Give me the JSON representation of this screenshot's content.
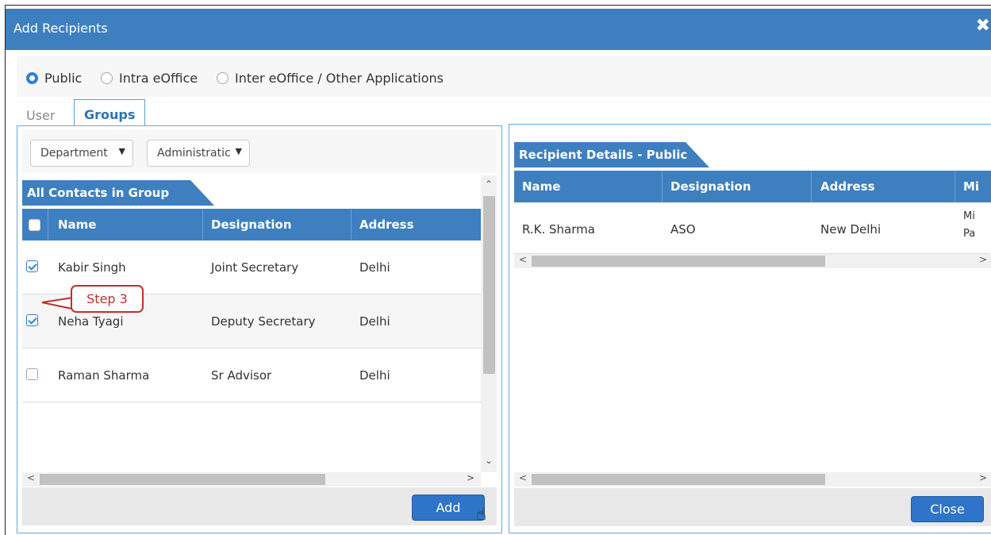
{
  "dialog": {
    "title": "Add Recipients",
    "close_icon": "close-icon"
  },
  "recipient_types": [
    {
      "label": "Public",
      "selected": true
    },
    {
      "label": "Intra eOffice",
      "selected": false
    },
    {
      "label": "Inter eOffice / Other Applications",
      "selected": false
    }
  ],
  "tabs": {
    "user": "User",
    "groups": "Groups",
    "active": "Groups"
  },
  "filters": {
    "category": "Department",
    "group": "Administratic"
  },
  "contacts": {
    "header": "All Contacts in Group",
    "columns": [
      "Name",
      "Designation",
      "Address"
    ],
    "rows": [
      {
        "name": "Kabir Singh",
        "designation": "Joint Secretary",
        "address": "Delhi",
        "checked": true
      },
      {
        "name": "Neha Tyagi",
        "designation": "Deputy Secretary",
        "address": "Delhi",
        "checked": true
      },
      {
        "name": "Raman Sharma",
        "designation": "Sr Advisor",
        "address": "Delhi",
        "checked": false
      }
    ]
  },
  "add_button": "Add",
  "callout": "Step 3",
  "recipients": {
    "header": "Recipient Details - Public",
    "columns": [
      "Name",
      "Designation",
      "Address",
      "Mi"
    ],
    "rows": [
      {
        "name": "R.K. Sharma",
        "designation": "ASO",
        "address": "New Delhi",
        "extra_line1": "Mi",
        "extra_line2": "Pa"
      }
    ]
  },
  "close_button": "Close",
  "colors": {
    "accent": "#3e7fc0",
    "callout": "#c0302c"
  }
}
